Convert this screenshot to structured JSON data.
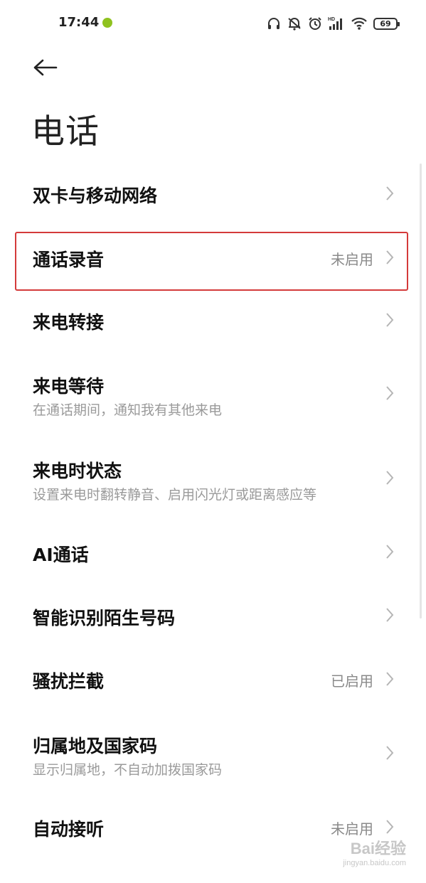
{
  "status_bar": {
    "time": "17:44",
    "battery": "69",
    "net_label": "HD"
  },
  "header": {
    "title": "电话"
  },
  "items": [
    {
      "title": "双卡与移动网络",
      "subtitle": "",
      "value": ""
    },
    {
      "title": "通话录音",
      "subtitle": "",
      "value": "未启用"
    },
    {
      "title": "来电转接",
      "subtitle": "",
      "value": ""
    },
    {
      "title": "来电等待",
      "subtitle": "在通话期间，通知我有其他来电",
      "value": ""
    },
    {
      "title": "来电时状态",
      "subtitle": "设置来电时翻转静音、启用闪光灯或距离感应等",
      "value": ""
    },
    {
      "title": "AI通话",
      "subtitle": "",
      "value": ""
    },
    {
      "title": "智能识别陌生号码",
      "subtitle": "",
      "value": ""
    },
    {
      "title": "骚扰拦截",
      "subtitle": "",
      "value": "已启用"
    },
    {
      "title": "归属地及国家码",
      "subtitle": "显示归属地，不自动加拨国家码",
      "value": ""
    },
    {
      "title": "自动接听",
      "subtitle": "",
      "value": "未启用"
    }
  ],
  "watermark": {
    "logo": "Bai经验",
    "url": "jingyan.baidu.com"
  },
  "colors": {
    "highlight_border": "#d43a3a",
    "status_dot": "#8fc21f"
  }
}
